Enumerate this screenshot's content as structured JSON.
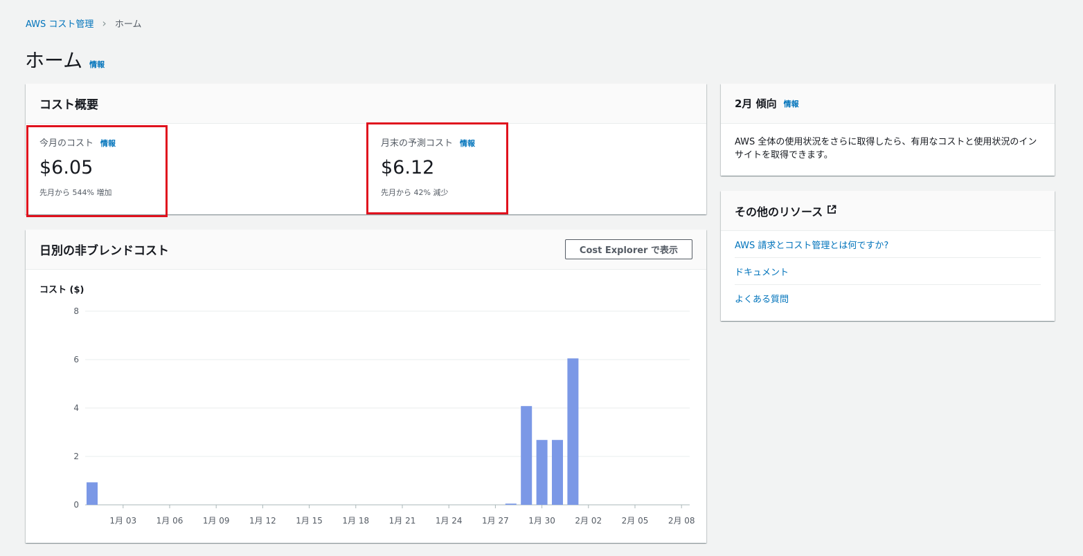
{
  "breadcrumb": {
    "root": "AWS コスト管理",
    "current": "ホーム"
  },
  "page": {
    "title": "ホーム",
    "info": "情報"
  },
  "cost_summary": {
    "title": "コスト概要",
    "this_month": {
      "label": "今月のコスト",
      "info": "情報",
      "value": "$6.05",
      "change": "先月から 544% 増加"
    },
    "forecast": {
      "label": "月末の予測コスト",
      "info": "情報",
      "value": "$6.12",
      "change": "先月から 42% 減少"
    }
  },
  "daily_cost": {
    "title": "日別の非ブレンドコスト",
    "button": "Cost Explorer で表示",
    "ylabel": "コスト ($)"
  },
  "trend": {
    "title": "2月 傾向",
    "info": "情報",
    "body": "AWS 全体の使用状況をさらに取得したら、有用なコストと使用状況のインサイトを取得できます。"
  },
  "resources": {
    "title": "その他のリソース",
    "items": [
      "AWS 請求とコスト管理とは何ですか?",
      "ドキュメント",
      "よくある質問"
    ]
  },
  "colors": {
    "bar": "#7b98e6",
    "highlight": "#e0111d",
    "link": "#0073bb"
  },
  "chart_data": {
    "type": "bar",
    "ylabel": "コスト ($)",
    "ylim": [
      0,
      8
    ],
    "yticks": [
      0,
      2,
      4,
      6,
      8
    ],
    "xticks": [
      "1月 03",
      "1月 06",
      "1月 09",
      "1月 12",
      "1月 15",
      "1月 18",
      "1月 21",
      "1月 24",
      "1月 27",
      "1月 30",
      "2月 02",
      "2月 05",
      "2月 08"
    ],
    "grid": true,
    "categories": [
      "1月 01",
      "1月 02",
      "1月 03",
      "1月 04",
      "1月 05",
      "1月 06",
      "1月 07",
      "1月 08",
      "1月 09",
      "1月 10",
      "1月 11",
      "1月 12",
      "1月 13",
      "1月 14",
      "1月 15",
      "1月 16",
      "1月 17",
      "1月 18",
      "1月 19",
      "1月 20",
      "1月 21",
      "1月 22",
      "1月 23",
      "1月 24",
      "1月 25",
      "1月 26",
      "1月 27",
      "1月 28",
      "1月 29",
      "1月 30",
      "1月 31",
      "2月 01",
      "2月 02",
      "2月 03",
      "2月 04",
      "2月 05",
      "2月 06",
      "2月 07",
      "2月 08"
    ],
    "values": [
      0.93,
      0,
      0,
      0,
      0,
      0,
      0,
      0,
      0,
      0,
      0,
      0,
      0,
      0,
      0,
      0,
      0,
      0,
      0,
      0,
      0,
      0,
      0,
      0,
      0,
      0,
      0,
      0.05,
      4.08,
      2.68,
      2.68,
      6.05,
      0,
      0,
      0,
      0,
      0,
      0,
      0
    ]
  }
}
